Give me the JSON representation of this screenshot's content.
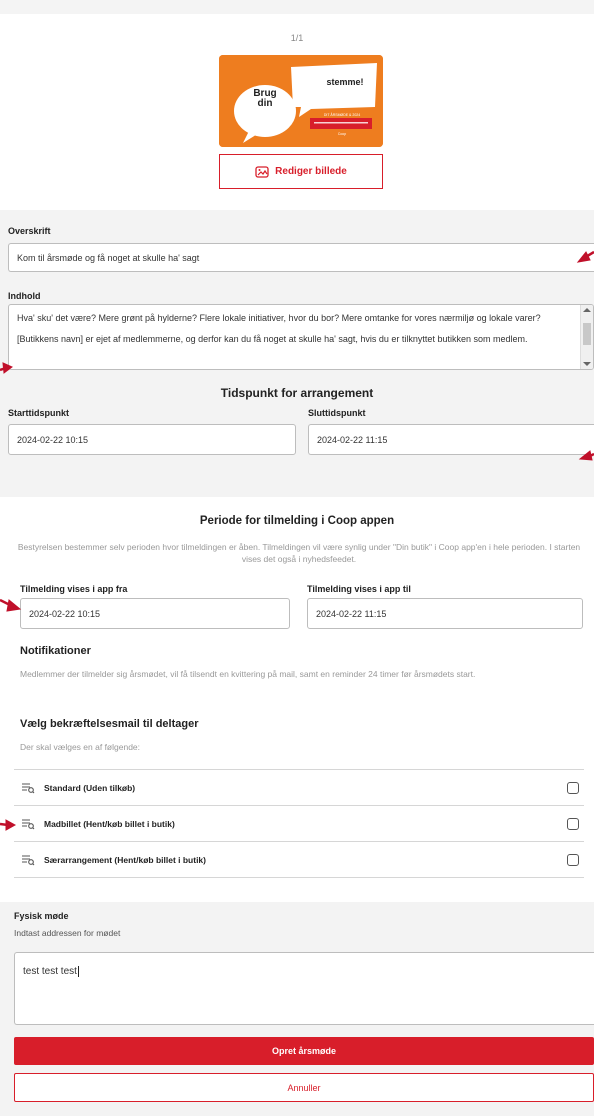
{
  "pager": "1/1",
  "poster": {
    "bubble_left": "Brug\ndin",
    "bubble_right": "stemme!",
    "fine_print_1": "DIT ÅRSMØDE & 2024",
    "fine_print_2": "Coop"
  },
  "edit_image_label": "Rediger billede",
  "heading_field": {
    "label": "Overskrift",
    "value": "Kom til årsmøde og få noget at skulle ha' sagt"
  },
  "content_field": {
    "label": "Indhold",
    "paragraph1": "Hva' sku' det være? Mere grønt på hylderne? Flere lokale initiativer, hvor du bor? Mere omtanke for vores nærmiljø og lokale varer?",
    "paragraph2": "[Butikkens navn] er ejet af medlemmerne, og derfor kan du få noget at skulle ha' sagt, hvis du er tilknyttet butikken som medlem."
  },
  "event_time": {
    "title": "Tidspunkt for arrangement",
    "start_label": "Starttidspunkt",
    "start_value": "2024-02-22 10:15",
    "end_label": "Sluttidspunkt",
    "end_value": "2024-02-22 11:15"
  },
  "signup": {
    "title": "Periode for tilmelding i Coop appen",
    "description": "Bestyrelsen bestemmer selv perioden hvor tilmeldingen er åben. Tilmeldingen vil være synlig under \"Din butik\" i Coop app'en i hele perioden. I starten vises det også i nyhedsfeedet.",
    "from_label": "Tilmelding vises i app fra",
    "from_value": "2024-02-22 10:15",
    "to_label": "Tilmelding vises i app til",
    "to_value": "2024-02-22 11:15"
  },
  "notifications": {
    "title": "Notifikationer",
    "text": "Medlemmer der tilmelder sig årsmødet, vil få tilsendt en kvittering på mail, samt en reminder 24 timer før årsmødets start."
  },
  "confirmation": {
    "title": "Vælg bekræftelsesmail til deltager",
    "hint": "Der skal vælges en af følgende:",
    "options": [
      {
        "label": "Standard (Uden tilkøb)",
        "icon": "document-search-icon",
        "checked": false
      },
      {
        "label": "Madbillet (Hent/køb billet i butik)",
        "icon": "document-search-icon",
        "checked": false
      },
      {
        "label": "Særarrangement (Hent/køb billet i butik)",
        "icon": "document-search-icon",
        "checked": false
      }
    ]
  },
  "physical": {
    "title": "Fysisk møde",
    "hint": "Indtast addressen for mødet",
    "value": "test test test"
  },
  "buttons": {
    "create": "Opret årsmøde",
    "cancel": "Annuller"
  },
  "colors": {
    "brand_red": "#d81e2a",
    "annotation_arrow": "#c0102a",
    "poster_orange": "#ee7d1f"
  }
}
